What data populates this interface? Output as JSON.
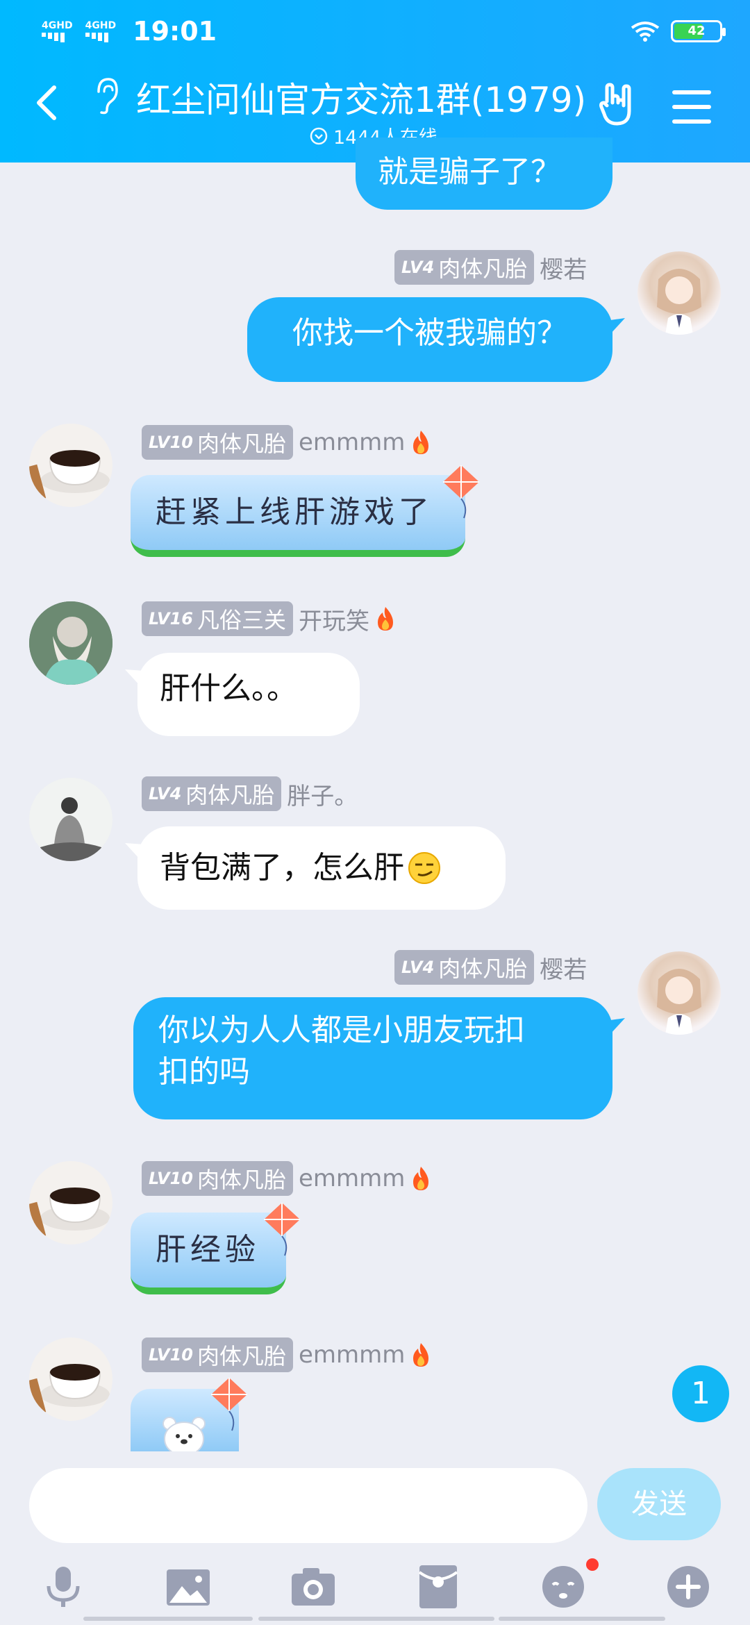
{
  "status_bar": {
    "signal1": "4GHD",
    "signal2": "4GHD",
    "time": "19:01",
    "battery": "42"
  },
  "header": {
    "title": "红尘问仙官方交流1群(1979)",
    "online": "1444人在线"
  },
  "colors": {
    "header": "#1ea7ff",
    "my_bubble": "#20b2fb",
    "badge": "#aeb2c1"
  },
  "messages": [
    {
      "side": "right",
      "text": "就是骗子了？",
      "partial": true
    },
    {
      "side": "right",
      "level": "LV4",
      "title": "肉体凡胎",
      "name": "樱若",
      "text": "你找一个被我骗的？"
    },
    {
      "side": "left",
      "level": "LV10",
      "title": "肉体凡胎",
      "name": "emmmm",
      "text": "赶紧上线肝游戏了",
      "style": "kite"
    },
    {
      "side": "left",
      "level": "LV16",
      "title": "凡俗三关",
      "name": "开玩笑",
      "text": "肝什么。。"
    },
    {
      "side": "left",
      "level": "LV4",
      "title": "肉体凡胎",
      "name": "胖子。",
      "text": "背包满了，怎么肝"
    },
    {
      "side": "right",
      "level": "LV4",
      "title": "肉体凡胎",
      "name": "樱若",
      "text_line1": "你以为人人都是小朋友玩扣",
      "text_line2": "扣的吗"
    },
    {
      "side": "left",
      "level": "LV10",
      "title": "肉体凡胎",
      "name": "emmmm",
      "text": "肝经验",
      "style": "kite"
    },
    {
      "side": "left",
      "level": "LV10",
      "title": "肉体凡胎",
      "name": "emmmm",
      "style": "kite",
      "sticker": "bear-icon"
    }
  ],
  "unread_count": "1",
  "input": {
    "placeholder": "",
    "send_label": "发送"
  },
  "toolbar": [
    "mic-icon",
    "image-icon",
    "camera-icon",
    "red-packet-icon",
    "emoji-icon",
    "plus-icon"
  ]
}
